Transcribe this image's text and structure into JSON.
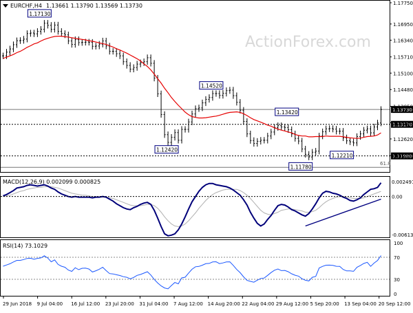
{
  "header": {
    "symbol": "EURCHF,H4",
    "ohlc": "1.13661 1.13790 1.13569 1.13730"
  },
  "watermark": "ActionForex.com",
  "colors": {
    "candles": "#000000",
    "moving_average": "#e60000",
    "macd_main": "#00007a",
    "macd_signal": "#b0b0b0",
    "trendline": "#000080",
    "rsi": "#1a57ff",
    "grid": "#000000",
    "label_box": "#000080",
    "background": "#ffffff"
  },
  "chart_data": [
    {
      "type": "candlestick",
      "title": "EURCHF,H4",
      "subtitle": "1.13661 1.13790 1.13569 1.13730",
      "ylim": [
        1.11375,
        1.1775
      ],
      "y_ticks": [
        "1.17750",
        "1.16950",
        "1.16340",
        "1.15710",
        "1.15100",
        "1.14480",
        "1.13850",
        "1.13230",
        "1.12620",
        "1.11990",
        "1.11375"
      ],
      "x_ticks": [
        "29 Jun 2018",
        "9 Jul 04:00",
        "16 Jul 12:00",
        "23 Jul 20:00",
        "31 Jul 04:00",
        "7 Aug 12:00",
        "14 Aug 20:00",
        "22 Aug 04:00",
        "29 Aug 12:00",
        "5 Sep 20:00",
        "13 Sep 04:00",
        "20 Sep 12:00"
      ],
      "price_labels": [
        {
          "text": "1.17130",
          "index": 14,
          "value": 1.1713
        },
        {
          "text": "1.14520",
          "index": 64,
          "value": 1.1452
        },
        {
          "text": "1.13420",
          "index": 86,
          "value": 1.1342
        },
        {
          "text": "1.12420",
          "index": 51,
          "value": 1.1242
        },
        {
          "text": "1.12210",
          "index": 102,
          "value": 1.1221
        },
        {
          "text": "1.11780",
          "index": 90,
          "value": 1.1178
        }
      ],
      "horizontal_levels": [
        {
          "value": 1.1373,
          "label": "1.13730",
          "style": "solid"
        },
        {
          "value": 1.1317,
          "label": "1.13170",
          "style": "dotted"
        },
        {
          "value": 1.1198,
          "label": "1.11980",
          "style": "dotted"
        },
        {
          "value": 1.1155,
          "label": "61.8",
          "style": "solid"
        }
      ],
      "series": [
        {
          "name": "",
          "kind": "close",
          "values": [
            1.1575,
            1.1589,
            1.1601,
            1.1617,
            1.1632,
            1.1633,
            1.1638,
            1.1659,
            1.1661,
            1.1658,
            1.1667,
            1.1675,
            1.1698,
            1.169,
            1.1675,
            1.1691,
            1.1667,
            1.1659,
            1.1654,
            1.1631,
            1.1618,
            1.1636,
            1.1625,
            1.1626,
            1.1627,
            1.1626,
            1.1611,
            1.1612,
            1.1619,
            1.1631,
            1.1612,
            1.1592,
            1.1592,
            1.1583,
            1.1575,
            1.1553,
            1.1539,
            1.1525,
            1.1531,
            1.1544,
            1.1549,
            1.1553,
            1.1568,
            1.1547,
            1.1491,
            1.1432,
            1.1354,
            1.1278,
            1.1249,
            1.1268,
            1.1286,
            1.1257,
            1.1298,
            1.1298,
            1.1326,
            1.1356,
            1.1376,
            1.1379,
            1.1398,
            1.1411,
            1.1418,
            1.1433,
            1.1433,
            1.1426,
            1.1434,
            1.1444,
            1.1446,
            1.1425,
            1.14,
            1.137,
            1.1328,
            1.1281,
            1.1256,
            1.1245,
            1.1253,
            1.1257,
            1.1257,
            1.1273,
            1.1288,
            1.1305,
            1.1312,
            1.1307,
            1.1305,
            1.1297,
            1.1281,
            1.1264,
            1.1254,
            1.1224,
            1.1204,
            1.1194,
            1.1212,
            1.1216,
            1.1273,
            1.1289,
            1.13,
            1.1301,
            1.1299,
            1.1291,
            1.1291,
            1.1266,
            1.1255,
            1.1251,
            1.1247,
            1.1271,
            1.1281,
            1.1295,
            1.13,
            1.1285,
            1.1307,
            1.1322,
            1.1373
          ]
        },
        {
          "name": "",
          "kind": "moving_average",
          "values": [
            1.1565,
            1.157,
            1.1575,
            1.158,
            1.1587,
            1.1592,
            1.1599,
            1.1607,
            1.1613,
            1.162,
            1.1624,
            1.1631,
            1.1637,
            1.1641,
            1.1645,
            1.1648,
            1.1649,
            1.1649,
            1.1647,
            1.1646,
            1.1643,
            1.1641,
            1.1639,
            1.1637,
            1.1635,
            1.1632,
            1.163,
            1.1627,
            1.1624,
            1.1621,
            1.1618,
            1.1613,
            1.1608,
            1.1602,
            1.1597,
            1.1591,
            1.1585,
            1.1578,
            1.1571,
            1.1564,
            1.1556,
            1.1545,
            1.1535,
            1.1522,
            1.1506,
            1.1489,
            1.1472,
            1.1453,
            1.1436,
            1.1418,
            1.1403,
            1.1389,
            1.1376,
            1.1363,
            1.1353,
            1.1346,
            1.1343,
            1.1341,
            1.1341,
            1.1342,
            1.1344,
            1.1346,
            1.1348,
            1.1351,
            1.1355,
            1.1359,
            1.1362,
            1.1363,
            1.1364,
            1.1362,
            1.1357,
            1.135,
            1.1342,
            1.1335,
            1.133,
            1.1325,
            1.132,
            1.1314,
            1.131,
            1.1304,
            1.1299,
            1.1295,
            1.1292,
            1.1288,
            1.1285,
            1.1279,
            1.1275,
            1.1273,
            1.1273,
            1.127,
            1.127,
            1.1271,
            1.1271,
            1.1271,
            1.1273,
            1.1272,
            1.1272,
            1.1272,
            1.1272,
            1.127,
            1.1268,
            1.1266,
            1.1265,
            1.1264,
            1.1265,
            1.1268,
            1.1271,
            1.1272,
            1.1273,
            1.1277,
            1.1285
          ]
        }
      ]
    },
    {
      "type": "line",
      "title": "MACD(12,26,9) 0.002099 0.000825",
      "ylim": [
        -0.00613,
        0.00249
      ],
      "y_ticks": [
        "0.002491",
        "0.00",
        "-0.006137"
      ],
      "series": [
        {
          "name": "",
          "kind": "macd_main",
          "values": [
            0.0001,
            0.0003,
            0.0006,
            0.0009,
            0.0013,
            0.0014,
            0.0015,
            0.0017,
            0.0018,
            0.0017,
            0.0016,
            0.0017,
            0.0018,
            0.0016,
            0.0013,
            0.0011,
            0.0007,
            0.0004,
            0.0002,
            0.0,
            -0.0001,
            0.0,
            -0.0001,
            -0.0001,
            -0.0001,
            -0.0001,
            -0.0002,
            -0.0001,
            -0.0001,
            -0.0,
            -0.0001,
            -0.0004,
            -0.0007,
            -0.0011,
            -0.0014,
            -0.0017,
            -0.0019,
            -0.002,
            -0.0017,
            -0.0015,
            -0.0012,
            -0.001,
            -0.0009,
            -0.0012,
            -0.0021,
            -0.0033,
            -0.0046,
            -0.0057,
            -0.006,
            -0.0059,
            -0.0057,
            -0.0051,
            -0.0042,
            -0.0031,
            -0.0019,
            -0.0008,
            0.0,
            0.0008,
            0.0014,
            0.0018,
            0.002,
            0.002,
            0.0018,
            0.0017,
            0.0016,
            0.0015,
            0.0013,
            0.001,
            0.0006,
            0.0002,
            -0.0005,
            -0.0013,
            -0.0024,
            -0.0033,
            -0.0041,
            -0.0045,
            -0.0042,
            -0.0035,
            -0.0029,
            -0.0021,
            -0.0014,
            -0.0012,
            -0.0013,
            -0.0016,
            -0.002,
            -0.0022,
            -0.0025,
            -0.0028,
            -0.003,
            -0.0026,
            -0.0019,
            -0.0011,
            -0.0002,
            0.0005,
            0.0008,
            0.0007,
            0.0005,
            0.0004,
            0.0002,
            -0.0001,
            -0.0003,
            -0.0006,
            -0.0007,
            -0.0005,
            -0.0002,
            0.0003,
            0.0007,
            0.0011,
            0.0012,
            0.0014,
            0.0021
          ]
        },
        {
          "name": "",
          "kind": "macd_signal",
          "values": [
            0.0,
            0.0001,
            0.0002,
            0.0004,
            0.0006,
            0.0008,
            0.0009,
            0.0011,
            0.0012,
            0.0013,
            0.0014,
            0.0014,
            0.0015,
            0.0015,
            0.0015,
            0.0014,
            0.0013,
            0.0011,
            0.0009,
            0.0007,
            0.0005,
            0.0004,
            0.0003,
            0.0002,
            0.0002,
            0.0001,
            0.0,
            -0.0,
            -0.0001,
            -0.0001,
            -0.0001,
            -0.0002,
            -0.0003,
            -0.0005,
            -0.0007,
            -0.0009,
            -0.0011,
            -0.0013,
            -0.0014,
            -0.0014,
            -0.0014,
            -0.0013,
            -0.0012,
            -0.0012,
            -0.0014,
            -0.0018,
            -0.0024,
            -0.0031,
            -0.0037,
            -0.0042,
            -0.0045,
            -0.0046,
            -0.0045,
            -0.0042,
            -0.0037,
            -0.0031,
            -0.0025,
            -0.0018,
            -0.0012,
            -0.0006,
            -0.0001,
            0.0003,
            0.0006,
            0.0008,
            0.001,
            0.0011,
            0.0011,
            0.0011,
            0.0011,
            0.0009,
            0.0006,
            0.0002,
            -0.0003,
            -0.0009,
            -0.0015,
            -0.0021,
            -0.0025,
            -0.0027,
            -0.0028,
            -0.0026,
            -0.0024,
            -0.0021,
            -0.002,
            -0.0019,
            -0.0019,
            -0.002,
            -0.0021,
            -0.0022,
            -0.0024,
            -0.0024,
            -0.0023,
            -0.0021,
            -0.0017,
            -0.0012,
            -0.0008,
            -0.0005,
            -0.0003,
            -0.0001,
            0.0,
            -0.0,
            -0.0001,
            -0.0002,
            -0.0003,
            -0.0003,
            -0.0003,
            -0.0002,
            -0.0,
            0.0002,
            0.0004,
            0.0006,
            0.0008
          ]
        },
        {
          "name": "",
          "kind": "trendline",
          "x": [
            88,
            110
          ],
          "values": [
            -0.0045,
            -0.0004
          ]
        }
      ]
    },
    {
      "type": "line",
      "title": "RSI(14) 73.1029",
      "ylim": [
        0,
        100
      ],
      "y_ticks": [
        "100",
        "70",
        "30",
        "0"
      ],
      "series": [
        {
          "name": "",
          "kind": "rsi",
          "values": [
            53.8,
            56.0,
            58.3,
            61.5,
            64.4,
            64.4,
            65.9,
            67.9,
            68.3,
            66.4,
            68.0,
            68.9,
            72.6,
            68.6,
            61.8,
            65.3,
            57.0,
            53.8,
            51.9,
            46.8,
            44.4,
            51.0,
            47.5,
            50.0,
            50.2,
            48.6,
            43.3,
            45.5,
            48.2,
            51.9,
            45.7,
            40.4,
            39.8,
            38.3,
            36.9,
            34.7,
            33.6,
            30.9,
            33.4,
            37.1,
            38.8,
            41.3,
            43.8,
            37.8,
            29.7,
            23.2,
            18.0,
            14.2,
            12.8,
            18.8,
            24.3,
            21.8,
            32.5,
            33.7,
            41.4,
            48.3,
            52.8,
            53.4,
            55.6,
            58.4,
            58.9,
            61.5,
            61.9,
            58.5,
            59.8,
            61.5,
            61.8,
            55.2,
            47.9,
            42.0,
            34.4,
            28.0,
            26.2,
            24.8,
            28.4,
            31.5,
            32.3,
            37.1,
            42.2,
            46.5,
            48.7,
            45.7,
            46.1,
            43.7,
            40.0,
            37.4,
            35.7,
            31.0,
            28.3,
            27.0,
            33.6,
            35.2,
            50.6,
            53.5,
            55.6,
            55.8,
            55.3,
            53.6,
            53.5,
            47.9,
            45.3,
            45.3,
            44.5,
            51.9,
            55.1,
            58.7,
            60.9,
            53.5,
            59.5,
            64.2,
            73.1
          ]
        }
      ],
      "levels": [
        70,
        30
      ]
    }
  ]
}
